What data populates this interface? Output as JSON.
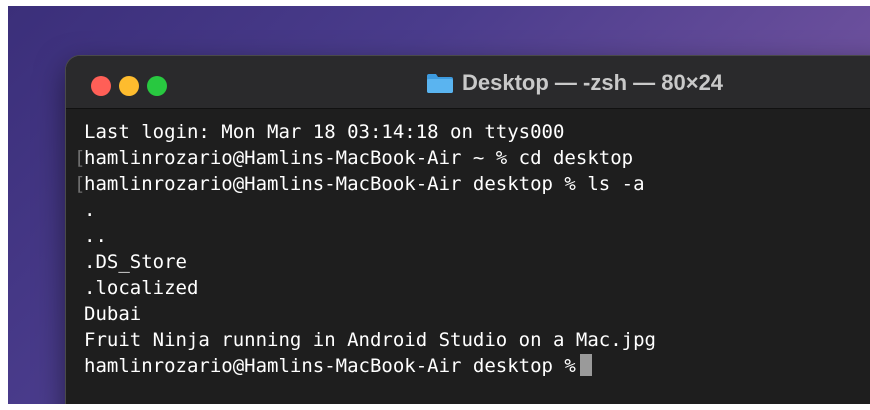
{
  "window": {
    "title": "Desktop — -zsh — 80×24",
    "title_icon": "folder-icon"
  },
  "terminal": {
    "lines": [
      "Last login: Mon Mar 18 03:14:18 on ttys000",
      "hamlinrozario@Hamlins-MacBook-Air ~ % cd desktop",
      "hamlinrozario@Hamlins-MacBook-Air desktop % ls -a",
      ".",
      "..",
      ".DS_Store",
      ".localized",
      "Dubai",
      "Fruit Ninja running in Android Studio on a Mac.jpg"
    ],
    "current_prompt": "hamlinrozario@Hamlins-MacBook-Air desktop %",
    "mark_glyph": "["
  },
  "colors": {
    "close": "#ff5f57",
    "minimize": "#febc2e",
    "zoom": "#28c840",
    "background": "#1e1e1e",
    "text": "#ffffff",
    "folder": "#5ab4f0"
  }
}
